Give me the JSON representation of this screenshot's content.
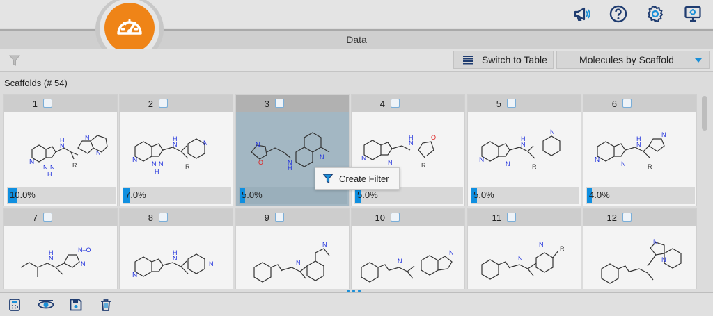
{
  "header": {
    "icons": [
      "dashboard-icon",
      "megaphone-icon",
      "help-icon",
      "settings-icon",
      "monitor-icon"
    ]
  },
  "panel": {
    "title": "Data"
  },
  "toolbar": {
    "switch_label": "Switch to Table",
    "view_select": "Molecules by Scaffold"
  },
  "scaffolds": {
    "title": "Scaffolds (# 54)",
    "cells": [
      {
        "num": "1",
        "pct": "10.0%",
        "fill": 0.1
      },
      {
        "num": "2",
        "pct": "7.0%",
        "fill": 0.07
      },
      {
        "num": "3",
        "pct": "5.0%",
        "fill": 0.05
      },
      {
        "num": "4",
        "pct": "5.0%",
        "fill": 0.05
      },
      {
        "num": "5",
        "pct": "5.0%",
        "fill": 0.05
      },
      {
        "num": "6",
        "pct": "4.0%",
        "fill": 0.04
      },
      {
        "num": "7",
        "pct": "",
        "fill": 0
      },
      {
        "num": "8",
        "pct": "",
        "fill": 0
      },
      {
        "num": "9",
        "pct": "",
        "fill": 0
      },
      {
        "num": "10",
        "pct": "",
        "fill": 0
      },
      {
        "num": "11",
        "pct": "",
        "fill": 0
      },
      {
        "num": "12",
        "pct": "",
        "fill": 0
      }
    ]
  },
  "context_menu": {
    "item": "Create Filter"
  },
  "footer": {
    "icons": [
      "calculator-icon",
      "view-icon",
      "save-icon",
      "trash-icon"
    ]
  },
  "colors": {
    "accent": "#1a8fd8",
    "logo": "#ef8417",
    "selected": "#a3b7c3"
  }
}
